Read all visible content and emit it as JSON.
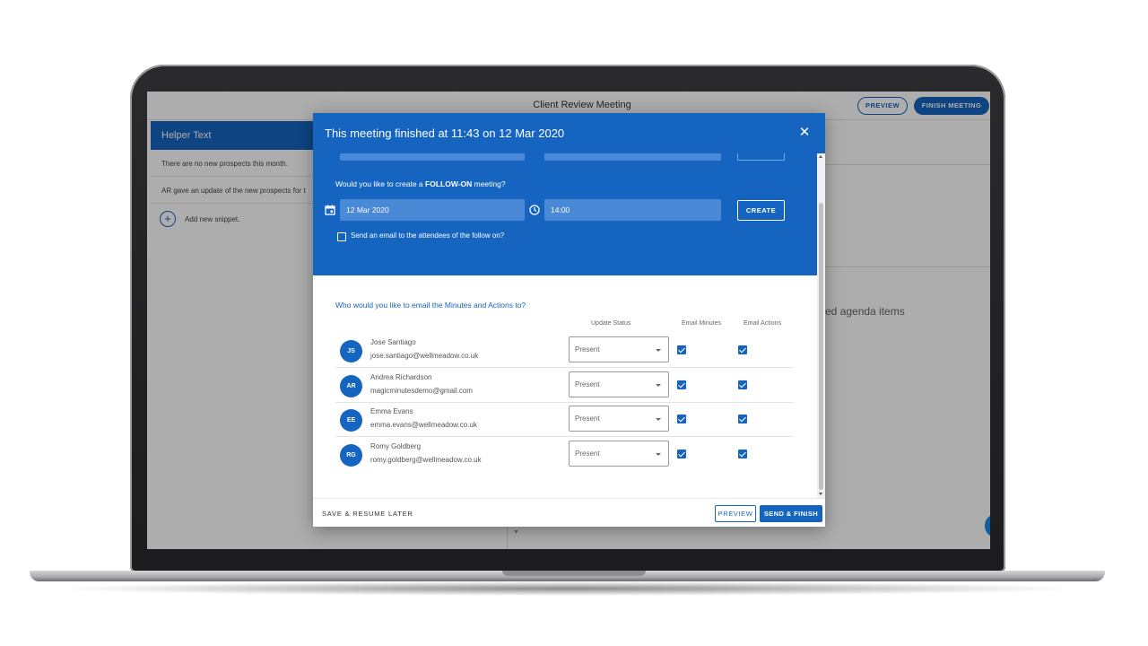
{
  "app": {
    "title": "Client Review Meeting",
    "preview_label": "PREVIEW",
    "finish_label": "FINISH MEETING"
  },
  "helper": {
    "header": "Helper Text",
    "snippets": [
      "There are no new prospects this month.",
      "AR gave an update of the new prospects for t"
    ],
    "add_label": "Add new snippet."
  },
  "background": {
    "agenda_text": "ed agenda items"
  },
  "dialog": {
    "title": "This meeting finished at 11:43 on 12 Mar 2020",
    "followon": {
      "question_prefix": "Would you like to create a ",
      "question_bold": "FOLLOW-ON",
      "question_suffix": " meeting?",
      "date": "12 Mar 2020",
      "time": "14:00",
      "create_label": "CREATE",
      "send_email_label": "Send an email to the attendees of the follow on?"
    },
    "email_question": "Who would you like to email the Minutes and Actions to?",
    "columns": {
      "status": "Update Status",
      "minutes": "Email Minutes",
      "actions": "Email Actions"
    },
    "attendees": [
      {
        "initials": "JS",
        "name": "Jose Santiago",
        "email": "jose.santiago@wellmeadow.co.uk",
        "status": "Present",
        "email_minutes": true,
        "email_actions": true
      },
      {
        "initials": "AR",
        "name": "Andrea Richardson",
        "email": "magicminutesdemo@gmail.com",
        "status": "Present",
        "email_minutes": true,
        "email_actions": true
      },
      {
        "initials": "EE",
        "name": "Emma Evans",
        "email": "emma.evans@wellmeadow.co.uk",
        "status": "Present",
        "email_minutes": true,
        "email_actions": true
      },
      {
        "initials": "RG",
        "name": "Romy Goldberg",
        "email": "romy.goldberg@wellmeadow.co.uk",
        "status": "Present",
        "email_minutes": true,
        "email_actions": true
      }
    ],
    "footer": {
      "save_resume": "SAVE & RESUME LATER",
      "preview": "PREVIEW",
      "send_finish": "SEND & FINISH"
    }
  },
  "colors": {
    "primary": "#1565c0",
    "field": "#4a89d5"
  }
}
